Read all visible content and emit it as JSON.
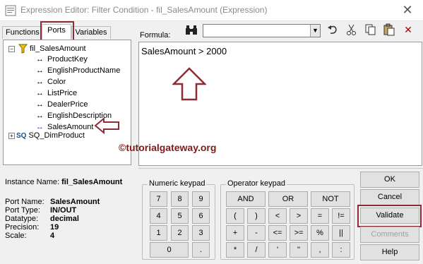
{
  "window": {
    "title": "Expression Editor: Filter Condition - fil_SalesAmount (Expression)",
    "close_glyph": "✕"
  },
  "tabs": [
    {
      "label": "Functions",
      "active": false
    },
    {
      "label": "Ports",
      "active": true
    },
    {
      "label": "Variables",
      "active": false
    }
  ],
  "tree": {
    "root": {
      "label": "fil_SalesAmount",
      "expander": "−"
    },
    "items": [
      {
        "label": "ProductKey",
        "arrow": "↔",
        "selected": false
      },
      {
        "label": "EnglishProductName",
        "arrow": "↔",
        "selected": false
      },
      {
        "label": "Color",
        "arrow": "↔",
        "selected": false
      },
      {
        "label": "ListPrice",
        "arrow": "↔",
        "selected": false
      },
      {
        "label": "DealerPrice",
        "arrow": "↔",
        "selected": false
      },
      {
        "label": "EnglishDescription",
        "arrow": "↔",
        "selected": false
      },
      {
        "label": "SalesAmount",
        "arrow": "↔",
        "selected": true
      }
    ],
    "source": {
      "label": "SQ_DimProduct",
      "icon_text": "SQ",
      "expander": "+"
    }
  },
  "instance": {
    "label": "Instance Name:",
    "value": "fil_SalesAmount"
  },
  "port_props": [
    {
      "key": "Port Name:",
      "value": "SalesAmount"
    },
    {
      "key": "Port Type:",
      "value": "IN/OUT"
    },
    {
      "key": "Datatype:",
      "value": "decimal"
    },
    {
      "key": "Precision:",
      "value": "19"
    },
    {
      "key": "Scale:",
      "value": "4"
    }
  ],
  "formula": {
    "label": "Formula:",
    "text": "SalesAmount > 2000",
    "search_value": ""
  },
  "toolbar_icons": [
    "binoculars-icon",
    "undo-icon",
    "copy-icon",
    "paste-icon",
    "delete-icon"
  ],
  "watermark": "©tutorialgateway.org",
  "numeric_keypad": {
    "title": "Numeric keypad",
    "rows": [
      [
        "7",
        "8",
        "9"
      ],
      [
        "4",
        "5",
        "6"
      ],
      [
        "1",
        "2",
        "3"
      ],
      [
        "0",
        "."
      ]
    ]
  },
  "operator_keypad": {
    "title": "Operator keypad",
    "row1": [
      "AND",
      "OR",
      "NOT"
    ],
    "rows": [
      [
        "(",
        ")",
        "<",
        ">",
        "=",
        "!="
      ],
      [
        "+",
        "-",
        "<=",
        ">=",
        "%",
        "||"
      ],
      [
        "*",
        "/",
        "'",
        "\"",
        ",",
        ":"
      ]
    ]
  },
  "side_buttons": {
    "ok": "OK",
    "cancel": "Cancel",
    "validate": "Validate",
    "comments": "Comments",
    "help": "Help"
  },
  "colors": {
    "highlight": "#8e2c34",
    "watermark": "#7d1a1a",
    "selected_arrow": "#2a3fd8"
  }
}
